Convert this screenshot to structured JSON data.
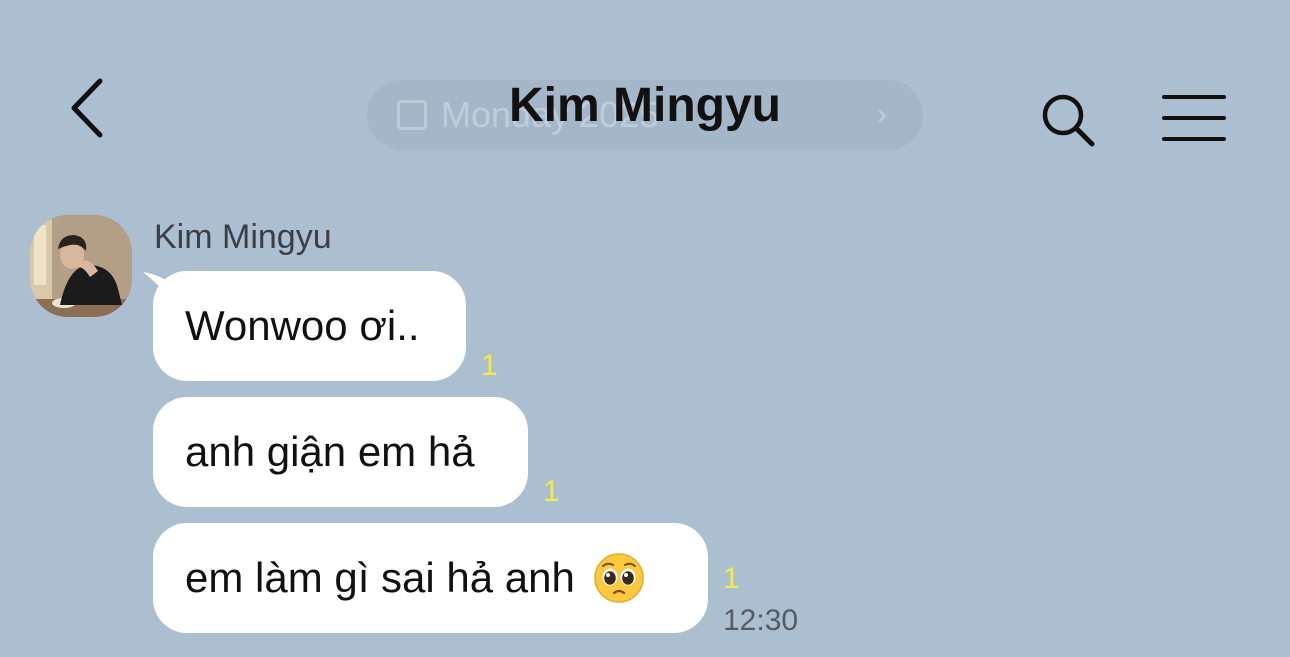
{
  "header": {
    "title": "Kim Mingyu",
    "date_pill_text": "Monday 2025",
    "back_icon": "chevron-left-icon",
    "search_icon": "search-icon",
    "menu_icon": "hamburger-menu-icon"
  },
  "chat": {
    "sender_name": "Kim Mingyu",
    "messages": [
      {
        "text": "Wonwoo ơi..",
        "unread": "1"
      },
      {
        "text": "anh giận em hả",
        "unread": "1"
      },
      {
        "text": "em làm gì sai hả anh",
        "unread": "1",
        "emoji": "pleading-face-emoji",
        "time": "12:30"
      }
    ]
  },
  "colors": {
    "background": "#acbfd0",
    "bubble": "#ffffff",
    "unread_count": "#f4ea4a"
  }
}
